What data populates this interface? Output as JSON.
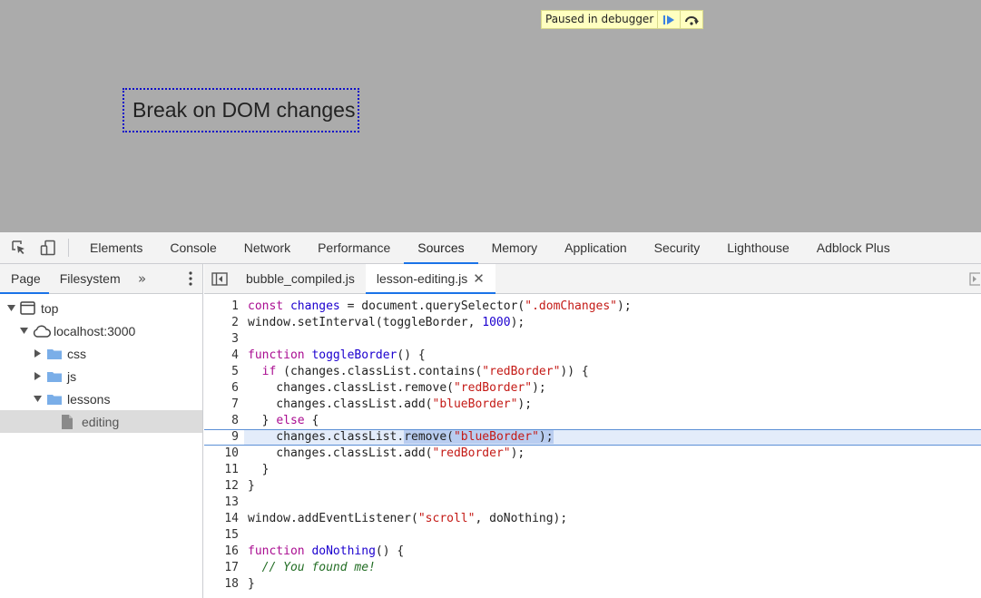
{
  "viewport": {
    "paused_label": "Paused in debugger",
    "dom_box_label": "Break on DOM changes"
  },
  "main_toolbar": {
    "tabs": [
      {
        "label": "Elements"
      },
      {
        "label": "Console"
      },
      {
        "label": "Network"
      },
      {
        "label": "Performance"
      },
      {
        "label": "Sources",
        "active": true
      },
      {
        "label": "Memory"
      },
      {
        "label": "Application"
      },
      {
        "label": "Security"
      },
      {
        "label": "Lighthouse"
      },
      {
        "label": "Adblock Plus"
      }
    ]
  },
  "navigator": {
    "tabs": [
      {
        "label": "Page",
        "active": true
      },
      {
        "label": "Filesystem"
      }
    ],
    "more": "»",
    "tree": [
      {
        "label": "top",
        "icon": "frame-icon",
        "arrow": "down"
      },
      {
        "label": "localhost:3000",
        "icon": "cloud-icon",
        "arrow": "down"
      },
      {
        "label": "css",
        "icon": "folder-icon",
        "arrow": "right"
      },
      {
        "label": "js",
        "icon": "folder-icon",
        "arrow": "right"
      },
      {
        "label": "lessons",
        "icon": "folder-icon",
        "arrow": "down"
      },
      {
        "label": "editing",
        "icon": "file-icon",
        "arrow": "none",
        "selected": true
      }
    ]
  },
  "editor": {
    "file_tabs": [
      {
        "label": "bubble_compiled.js"
      },
      {
        "label": "lesson-editing.js",
        "active": true,
        "closable": true
      }
    ],
    "close_glyph": "✕",
    "lines": [
      {
        "n": "1"
      },
      {
        "n": "2"
      },
      {
        "n": "3"
      },
      {
        "n": "4"
      },
      {
        "n": "5"
      },
      {
        "n": "6"
      },
      {
        "n": "7"
      },
      {
        "n": "8"
      },
      {
        "n": "9"
      },
      {
        "n": "10"
      },
      {
        "n": "11"
      },
      {
        "n": "12"
      },
      {
        "n": "13"
      },
      {
        "n": "14"
      },
      {
        "n": "15"
      },
      {
        "n": "16"
      },
      {
        "n": "17"
      },
      {
        "n": "18"
      }
    ],
    "code": {
      "l1_kw": "const",
      "l1_def": " changes",
      "l1_a": " = document.querySelector(",
      "l1_str": "\".domChanges\"",
      "l1_b": ");",
      "l2_a": "window.setInterval(toggleBorder, ",
      "l2_num": "1000",
      "l2_b": ");",
      "l4_kw": "function",
      "l4_def": " toggleBorder",
      "l4_a": "() {",
      "l5_a": "  ",
      "l5_kw": "if",
      "l5_b": " (changes.classList.contains(",
      "l5_str": "\"redBorder\"",
      "l5_c": ")) {",
      "l6_a": "    changes.classList.remove(",
      "l6_str": "\"redBorder\"",
      "l6_b": ");",
      "l7_a": "    changes.classList.add(",
      "l7_str": "\"blueBorder\"",
      "l7_b": ");",
      "l8_a": "  } ",
      "l8_kw": "else",
      "l8_b": " {",
      "l9_a": "    changes.classList.",
      "l9_hl1": "remove(",
      "l9_str": "\"blueBorder\"",
      "l9_hl2": ");",
      "l10_a": "    changes.classList.add(",
      "l10_str": "\"redBorder\"",
      "l10_b": ");",
      "l11_a": "  }",
      "l12_a": "}",
      "l14_a": "window.addEventListener(",
      "l14_str": "\"scroll\"",
      "l14_b": ", doNothing);",
      "l16_kw": "function",
      "l16_def": " doNothing",
      "l16_a": "() {",
      "l17_a": "  ",
      "l17_cm": "// You found me!",
      "l18_a": "}"
    },
    "exec_line": "9"
  },
  "colors": {
    "accent": "#1a73e8",
    "viewport_bg": "#ababab",
    "paused_bg": "#ffffc0",
    "exec_line_bg": "#e3ecfa",
    "folder": "#7aaee8"
  }
}
